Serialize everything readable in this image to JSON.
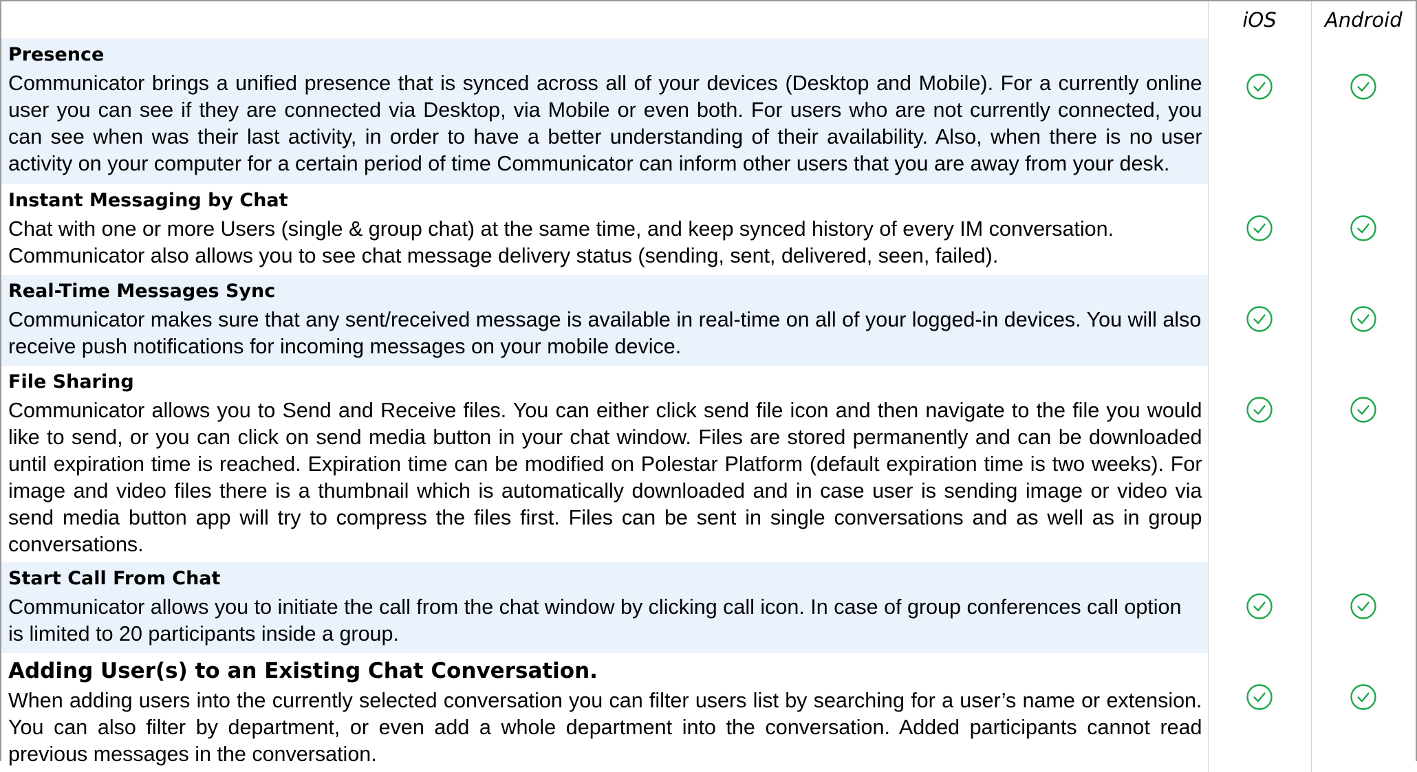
{
  "header": {
    "platforms": [
      "iOS",
      "Android"
    ]
  },
  "colors": {
    "row_shade": "#eaf2fc",
    "check": "#1fa64a",
    "border": "#9a9a9a"
  },
  "features": [
    {
      "title": "Presence",
      "description": "Communicator brings a unified presence that is synced across all of your devices (Desktop and Mobile). For a currently online user you can see if they are connected via Desktop, via Mobile or even both. For users who are not currently connected, you can see when was their last activity, in order to have a better understanding of their availability. Also, when there is no user activity on your computer for a certain period of time Communicator can inform other users that you are away from your desk.",
      "ios": "check-circle-icon",
      "android": "check-circle-icon"
    },
    {
      "title": "Instant Messaging by Chat",
      "description": "Chat with one or more Users (single & group chat) at the same time, and keep synced history of every IM conversation. Communicator also allows you to see chat message delivery status (sending, sent, delivered, seen, failed).",
      "ios": "check-circle-icon",
      "android": "check-circle-icon"
    },
    {
      "title": "Real-Time Messages Sync",
      "description": "Communicator makes sure that any sent/received message is available in real-time on all of your logged-in devices. You will also receive push notifications for incoming messages on your mobile device.",
      "ios": "check-circle-icon",
      "android": "check-circle-icon"
    },
    {
      "title": "File Sharing",
      "description": "Communicator allows you to Send and Receive files. You can either click send file icon and then navigate to the file you would like to send, or you can click on send media button in your chat window. Files are stored permanently and can be downloaded until expiration time is reached. Expiration time can be modified on Polestar Platform (default expiration time is two weeks). For image and video files there is a thumbnail which is automatically downloaded and in case user is sending image or video via send media button app will try to compress the files first. Files can be sent in single conversations and as well as in group conversations.",
      "ios": "check-circle-icon",
      "android": "check-circle-icon"
    },
    {
      "title": "Start Call From Chat",
      "description": "Communicator allows you to initiate the call from the chat window by clicking call icon. In case of group conferences call option is limited to 20 participants inside a group.",
      "ios": "check-circle-icon",
      "android": "check-circle-icon"
    },
    {
      "title": "Adding User(s) to an Existing Chat Conversation.",
      "description": "When adding users into the currently selected conversation you can filter users list by searching for a user’s name or extension. You can also filter by department, or even add a whole department into the conversation. Added participants cannot read previous messages in the conversation.",
      "ios": "check-circle-icon",
      "android": "check-circle-icon"
    }
  ]
}
